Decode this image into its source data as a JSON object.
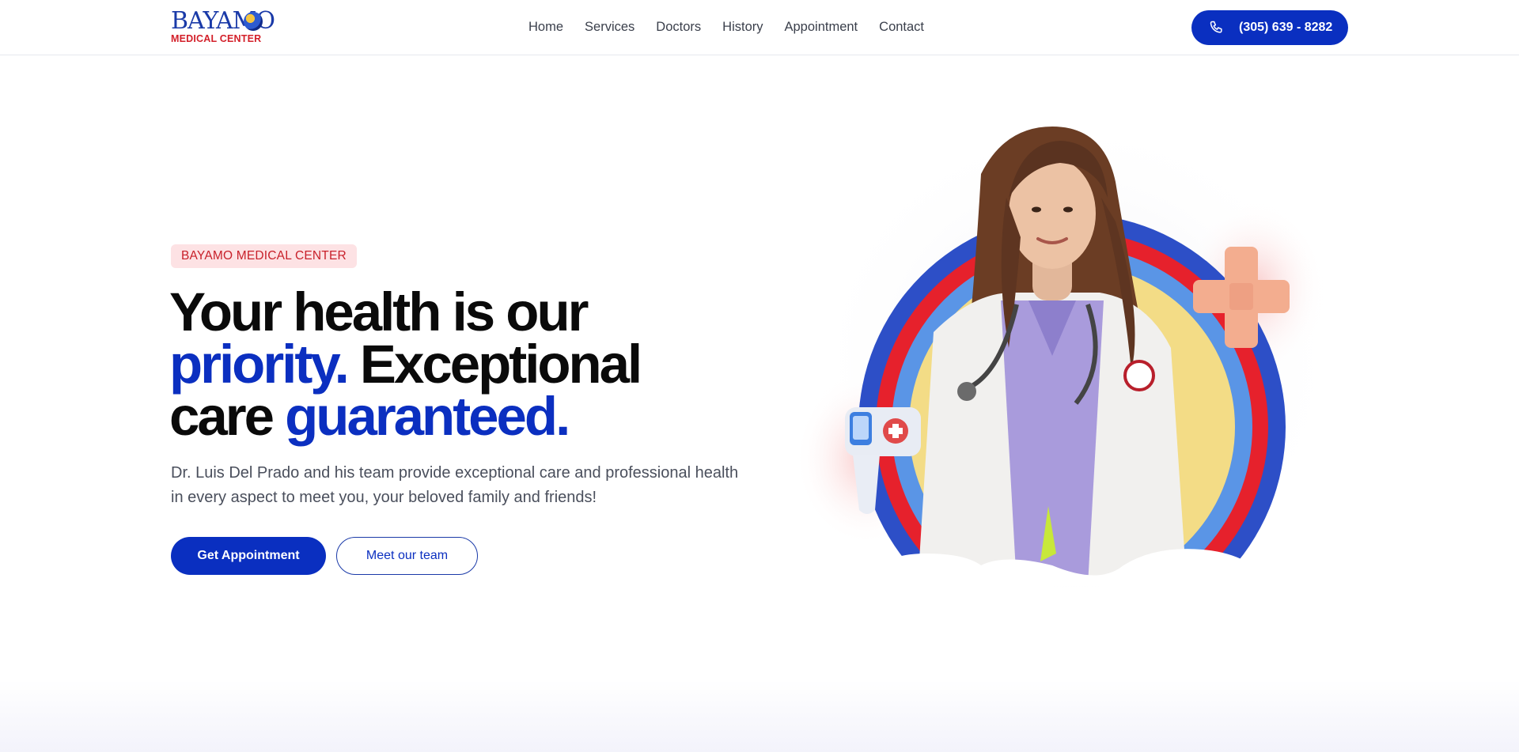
{
  "header": {
    "logo": {
      "top_text": "BAYAMO",
      "bottom_text": "MEDICAL CENTER"
    },
    "nav": [
      {
        "label": "Home"
      },
      {
        "label": "Services"
      },
      {
        "label": "Doctors"
      },
      {
        "label": "History"
      },
      {
        "label": "Appointment"
      },
      {
        "label": "Contact"
      }
    ],
    "phone": {
      "label": "(305) 639 - 8282",
      "icon": "phone-icon"
    }
  },
  "hero": {
    "badge": "BAYAMO MEDICAL CENTER",
    "headline": {
      "part1": "Your health is our",
      "part2_blue": "priority.",
      "part3": " Exceptional",
      "part4": "care ",
      "part5_blue": "guaranteed."
    },
    "subtext": "Dr. Luis Del Prado and his team provide exceptional care and professional health in every aspect to meet you, your beloved family and friends!",
    "primary_button": "Get Appointment",
    "secondary_button": "Meet our team"
  },
  "colors": {
    "brand_blue": "#0a2fc0",
    "brand_red": "#d3202a",
    "badge_bg": "#fde2e4",
    "ring_light_blue": "#5a95e6",
    "ring_yellow": "#f3dc86"
  }
}
